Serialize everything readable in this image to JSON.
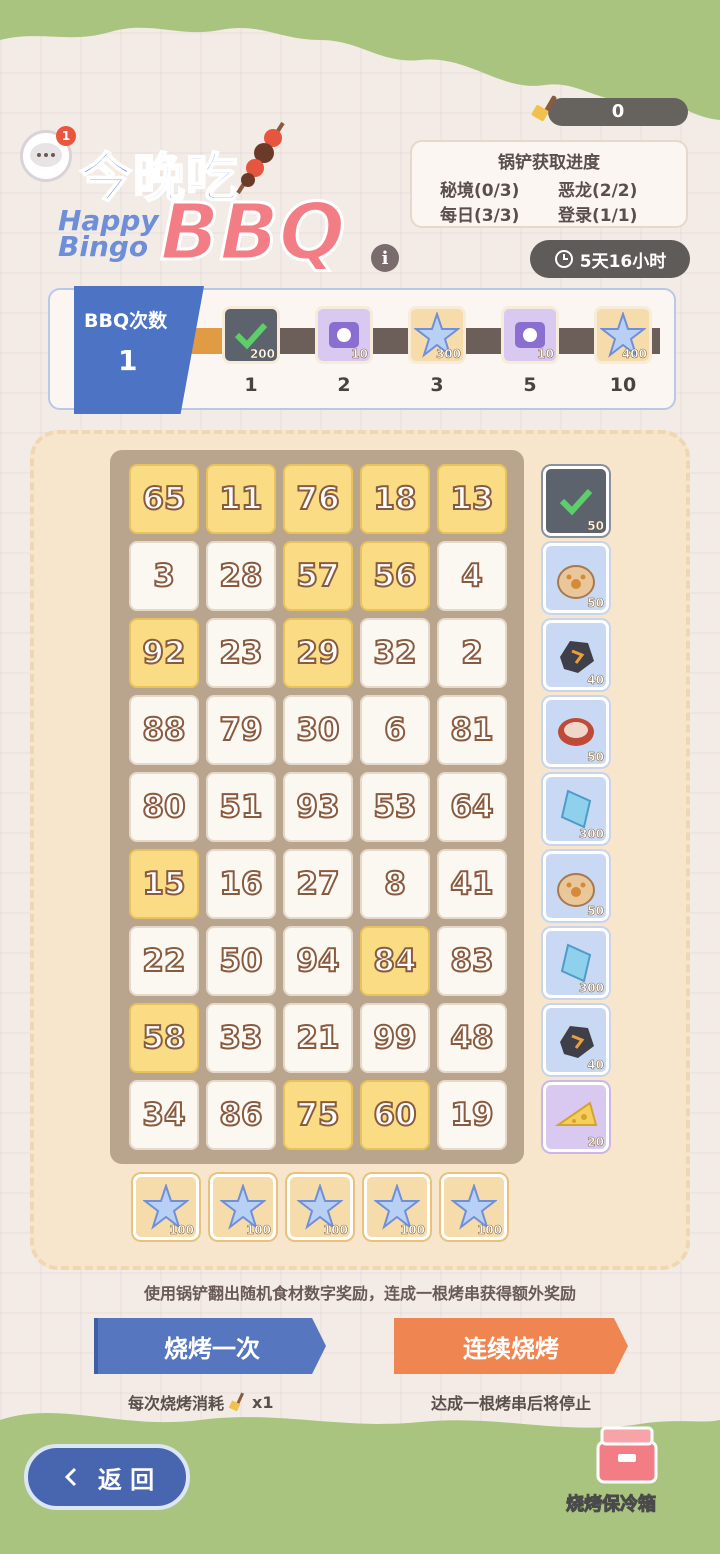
{
  "header": {
    "currency_value": "0",
    "avatar_badge": "1",
    "logo_cn": "今晚吃",
    "logo_happy": "Happy",
    "logo_bingo": "Bingo",
    "logo_bbq": "BBQ",
    "info_label": "i",
    "timer": "5天16小时"
  },
  "progress": {
    "title": "锅铲获取进度",
    "items": [
      "秘境(0/3)",
      "恶龙(2/2)",
      "每日(3/3)",
      "登录(1/1)"
    ]
  },
  "track": {
    "label_title": "BBQ次数",
    "label_count": "1",
    "fill_fraction": 0.05,
    "milestones": [
      {
        "index": "1",
        "amount": "200",
        "type": "done"
      },
      {
        "index": "2",
        "amount": "10",
        "type": "purple"
      },
      {
        "index": "3",
        "amount": "300",
        "type": "gold"
      },
      {
        "index": "5",
        "amount": "10",
        "type": "purple"
      },
      {
        "index": "10",
        "amount": "400",
        "type": "gold"
      }
    ]
  },
  "board": {
    "rows": [
      [
        {
          "n": "65",
          "g": true
        },
        {
          "n": "11",
          "g": true
        },
        {
          "n": "76",
          "g": true
        },
        {
          "n": "18",
          "g": true
        },
        {
          "n": "13",
          "g": true
        }
      ],
      [
        {
          "n": "3",
          "g": false
        },
        {
          "n": "28",
          "g": false
        },
        {
          "n": "57",
          "g": true
        },
        {
          "n": "56",
          "g": true
        },
        {
          "n": "4",
          "g": false
        }
      ],
      [
        {
          "n": "92",
          "g": true
        },
        {
          "n": "23",
          "g": false
        },
        {
          "n": "29",
          "g": true
        },
        {
          "n": "32",
          "g": false
        },
        {
          "n": "2",
          "g": false
        }
      ],
      [
        {
          "n": "88",
          "g": false
        },
        {
          "n": "79",
          "g": false
        },
        {
          "n": "30",
          "g": false
        },
        {
          "n": "6",
          "g": false
        },
        {
          "n": "81",
          "g": false
        }
      ],
      [
        {
          "n": "80",
          "g": false
        },
        {
          "n": "51",
          "g": false
        },
        {
          "n": "93",
          "g": false
        },
        {
          "n": "53",
          "g": false
        },
        {
          "n": "64",
          "g": false
        }
      ],
      [
        {
          "n": "15",
          "g": true
        },
        {
          "n": "16",
          "g": false
        },
        {
          "n": "27",
          "g": false
        },
        {
          "n": "8",
          "g": false
        },
        {
          "n": "41",
          "g": false
        }
      ],
      [
        {
          "n": "22",
          "g": false
        },
        {
          "n": "50",
          "g": false
        },
        {
          "n": "94",
          "g": false
        },
        {
          "n": "84",
          "g": true
        },
        {
          "n": "83",
          "g": false
        }
      ],
      [
        {
          "n": "58",
          "g": true
        },
        {
          "n": "33",
          "g": false
        },
        {
          "n": "21",
          "g": false
        },
        {
          "n": "99",
          "g": false
        },
        {
          "n": "48",
          "g": false
        }
      ],
      [
        {
          "n": "34",
          "g": false
        },
        {
          "n": "86",
          "g": false
        },
        {
          "n": "75",
          "g": true
        },
        {
          "n": "60",
          "g": true
        },
        {
          "n": "19",
          "g": false
        }
      ]
    ],
    "row_rewards": [
      {
        "amount": "50",
        "type": "done",
        "icon": "check-icon"
      },
      {
        "amount": "50",
        "type": "blue",
        "icon": "paw-bag-icon"
      },
      {
        "amount": "40",
        "type": "blue",
        "icon": "ore-icon"
      },
      {
        "amount": "50",
        "type": "blue",
        "icon": "meat-icon"
      },
      {
        "amount": "300",
        "type": "blue",
        "icon": "crystal-icon"
      },
      {
        "amount": "50",
        "type": "blue",
        "icon": "paw-bag-icon"
      },
      {
        "amount": "300",
        "type": "blue",
        "icon": "crystal-icon"
      },
      {
        "amount": "40",
        "type": "blue",
        "icon": "ore-icon"
      },
      {
        "amount": "20",
        "type": "purple",
        "icon": "cheese-icon"
      }
    ],
    "col_rewards": [
      "100",
      "100",
      "100",
      "100",
      "100"
    ]
  },
  "hint": "使用锅铲翻出随机食材数字奖励，连成一根烤串获得额外奖励",
  "actions": {
    "once_label": "烧烤一次",
    "once_sub": "每次烧烤消耗",
    "once_cost": "x1",
    "continuous_label": "连续烧烤",
    "continuous_sub": "达成一根烤串后将停止"
  },
  "footer": {
    "back_label": "返 回",
    "cooler_label": "烧烤保冷箱"
  },
  "colors": {
    "accent_blue": "#5676bf",
    "accent_orange": "#ef8652",
    "gold_cell": "#f9dc83",
    "green_wave": "#a9c47f"
  }
}
